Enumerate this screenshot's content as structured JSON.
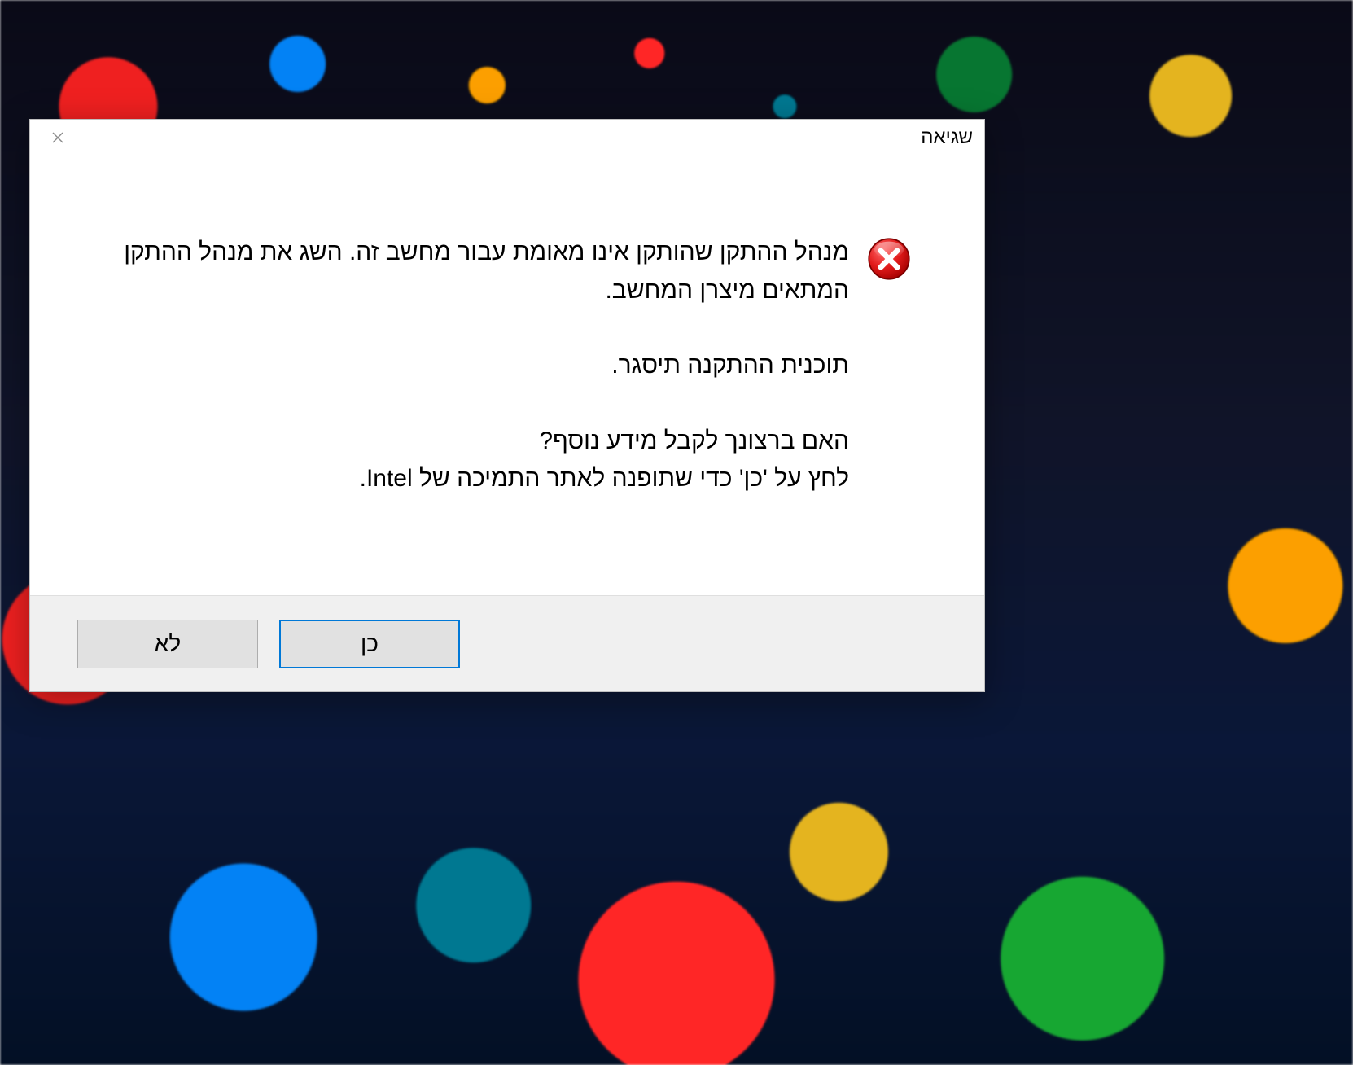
{
  "dialog": {
    "title": "שגיאה",
    "message": {
      "line1": "מנהל ההתקן שהותקן אינו מאומת עבור מחשב זה. השג את מנהל ההתקן המתאים מיצרן המחשב.",
      "line2": "תוכנית ההתקנה תיסגר.",
      "line3": "האם ברצונך לקבל מידע נוסף?",
      "line4": "לחץ על 'כן' כדי שתופנה לאתר התמיכה של Intel."
    },
    "buttons": {
      "yes": "כן",
      "no": "לא"
    }
  }
}
